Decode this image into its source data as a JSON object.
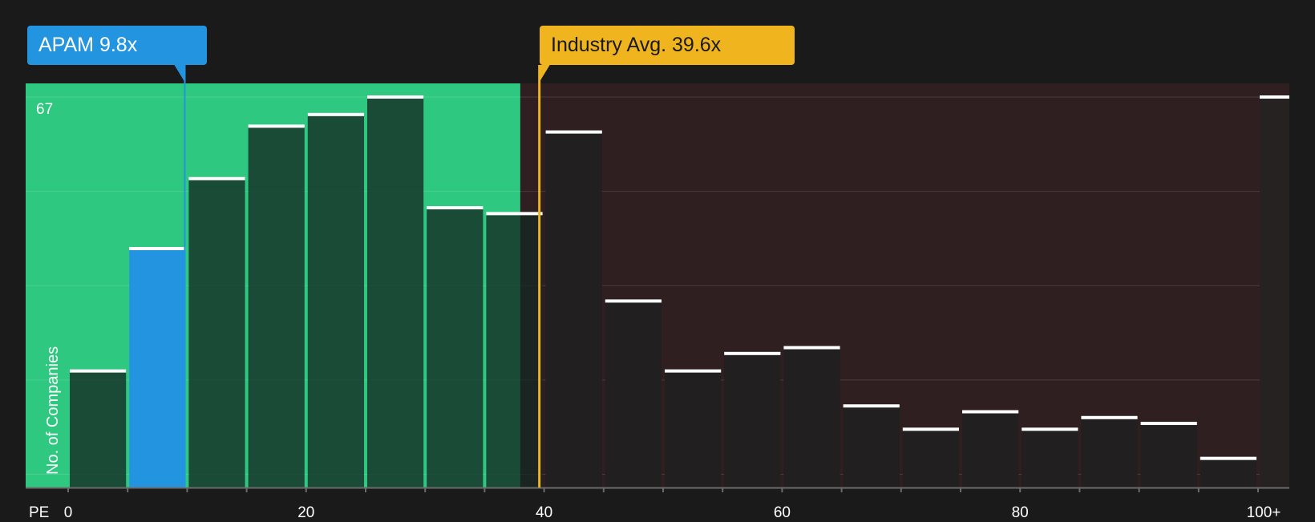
{
  "chart_data": {
    "type": "bar",
    "title": "",
    "xlabel": "PE",
    "ylabel": "No. of Companies",
    "y_max_label": "67",
    "ylim": [
      0,
      69
    ],
    "x_range": [
      0,
      103
    ],
    "bin_width": 5,
    "categories": [
      "0-5",
      "5-10",
      "10-15",
      "15-20",
      "20-25",
      "25-30",
      "30-35",
      "35-40",
      "40-45",
      "45-50",
      "50-55",
      "55-60",
      "60-65",
      "65-70",
      "70-75",
      "75-80",
      "80-85",
      "85-90",
      "90-95",
      "95-100",
      "100+"
    ],
    "bin_starts": [
      0,
      5,
      10,
      15,
      20,
      25,
      30,
      35,
      40,
      45,
      50,
      55,
      60,
      65,
      70,
      75,
      80,
      85,
      90,
      95,
      100
    ],
    "values": [
      20,
      41,
      53,
      62,
      64,
      67,
      48,
      47,
      61,
      32,
      20,
      23,
      24,
      14,
      10,
      13,
      10,
      12,
      11,
      5,
      67
    ],
    "x_ticks": [
      {
        "value": 0,
        "label": "0"
      },
      {
        "value": 20,
        "label": "20"
      },
      {
        "value": 40,
        "label": "40"
      },
      {
        "value": 60,
        "label": "60"
      },
      {
        "value": 80,
        "label": "80"
      },
      {
        "value": 100,
        "label": "100+"
      }
    ],
    "gridlines": true,
    "markers": {
      "company": {
        "label": "APAM 9.8x",
        "value": 9.8,
        "color": "#2394e0"
      },
      "industry": {
        "label": "Industry Avg. 39.6x",
        "value": 39.6,
        "color": "#f0b51e"
      }
    },
    "zones": {
      "undervalued_color": "#2ec880",
      "overvalued_color": "#2f1f20"
    }
  }
}
